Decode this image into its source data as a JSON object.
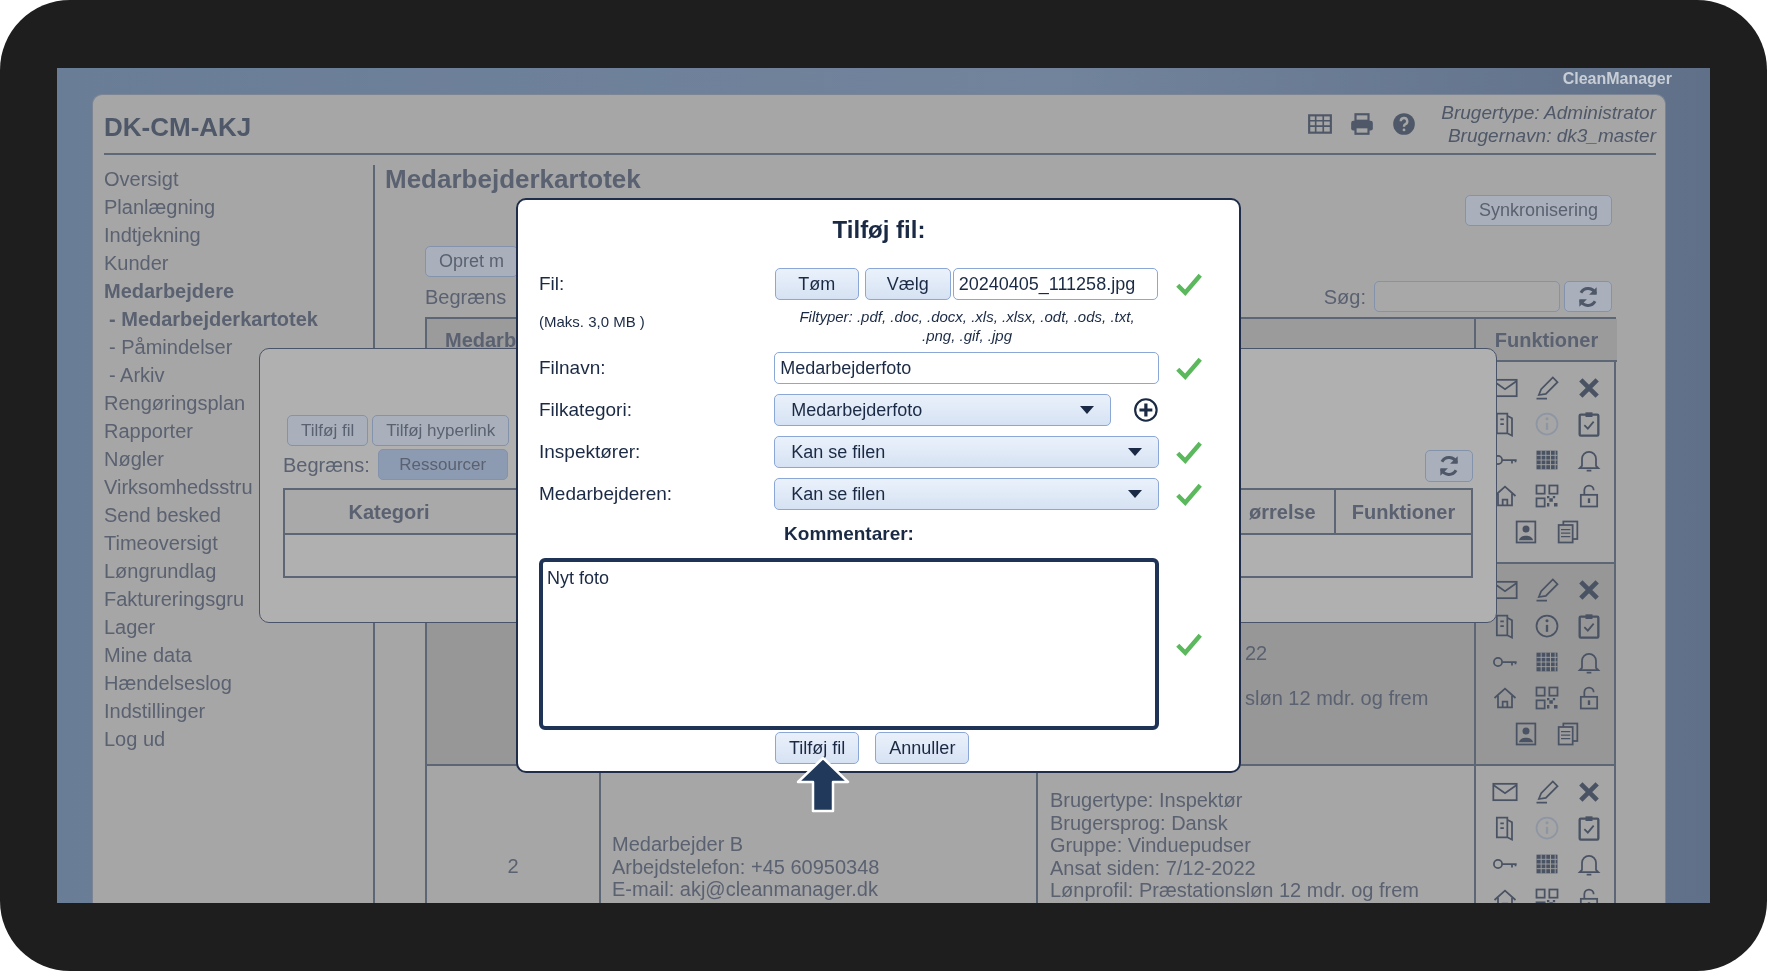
{
  "brand": "CleanManager",
  "header": {
    "title": "DK-CM-AKJ",
    "user_type": "Brugertype: Administrator",
    "user_name": "Brugernavn: dk3_master"
  },
  "sidebar": {
    "items": [
      {
        "label": "Oversigt",
        "selected": false
      },
      {
        "label": "Planlægning",
        "selected": false
      },
      {
        "label": "Indtjekning",
        "selected": false
      },
      {
        "label": "Kunder",
        "selected": false
      },
      {
        "label": "Medarbejdere",
        "selected": true,
        "children": [
          {
            "label": "- Medarbejderkartotek",
            "selected": true
          },
          {
            "label": "- Påmindelser",
            "selected": false
          },
          {
            "label": "- Arkiv",
            "selected": false
          }
        ]
      },
      {
        "label": "Rengøringsplan",
        "selected": false
      },
      {
        "label": "Rapporter",
        "selected": false
      },
      {
        "label": "Nøgler",
        "selected": false
      },
      {
        "label": "Virksomhedsstru",
        "selected": false
      },
      {
        "label": "Send besked",
        "selected": false
      },
      {
        "label": "Timeoversigt",
        "selected": false
      },
      {
        "label": "Løngrundlag",
        "selected": false
      },
      {
        "label": "Faktureringsgru",
        "selected": false
      },
      {
        "label": "Lager",
        "selected": false
      },
      {
        "label": "Mine data",
        "selected": false
      },
      {
        "label": "Hændelseslog",
        "selected": false
      },
      {
        "label": "Indstillinger",
        "selected": false
      },
      {
        "label": "Log ud",
        "selected": false
      }
    ]
  },
  "page": {
    "title": "Medarbejderkartotek",
    "sync_button": "Synkronisering",
    "create_button": "Opret m",
    "filter_label": "Begræns",
    "search_label": "Søg:"
  },
  "table": {
    "columns": [
      {
        "label": "Medarb"
      },
      {
        "label": "Funktioner"
      }
    ],
    "rows": [
      {
        "selected": false,
        "info_enabled": false
      },
      {
        "selected": true,
        "details": [
          "22",
          "sløn 12 mdr. og frem"
        ],
        "info_enabled": true
      },
      {
        "selected": false,
        "number": "2",
        "contact": [
          "Medarbejder B",
          "Arbejdstelefon: +45 60950348",
          "E-mail: akj@cleanmanager.dk"
        ],
        "details": [
          "Brugertype: Inspektør",
          "Brugersprog: Dansk",
          "Gruppe: Vinduepudser",
          "Ansat siden: 7/12-2022",
          "Lønprofil: Præstationsløn 12 mdr. og frem"
        ],
        "info_enabled": false
      }
    ]
  },
  "files_dialog": {
    "buttons": [
      {
        "label": "Tilføj fil"
      },
      {
        "label": "Tilføj hyperlink"
      }
    ],
    "filter_label": "Begræns:",
    "filters": [
      {
        "label": "Ressourcer",
        "selected": true
      }
    ],
    "columns": [
      {
        "label": "Kategori"
      },
      {
        "label": "ørrelse"
      },
      {
        "label": "Funktioner"
      }
    ]
  },
  "add_file_dialog": {
    "title": "Tilføj fil:",
    "file": {
      "label": "Fil:",
      "note": "(Maks. 3,0 MB )",
      "clear_button": "Tøm",
      "choose_button": "Vælg",
      "value": "20240405_111258.jpg",
      "file_types": "Filtyper: .pdf, .doc, .docx, .xls, .xlsx, .odt, .ods, .txt, .png, .gif, .jpg",
      "valid": true
    },
    "fields": [
      {
        "kind": "text",
        "label": "Filnavn:",
        "value": "Medarbejderfoto",
        "valid": true,
        "can_add": false
      },
      {
        "kind": "select",
        "label": "Filkategori:",
        "value": "Medarbejderfoto",
        "valid": false,
        "can_add": true
      },
      {
        "kind": "select",
        "label": "Inspektører:",
        "value": "Kan se filen",
        "valid": true,
        "can_add": false
      },
      {
        "kind": "select",
        "label": "Medarbejderen:",
        "value": "Kan se filen",
        "valid": true,
        "can_add": false
      }
    ],
    "comments": {
      "label": "Kommentarer:",
      "value": "Nyt foto",
      "valid": true
    },
    "buttons": [
      {
        "label": "Tilføj fil"
      },
      {
        "label": "Annuller"
      }
    ]
  }
}
